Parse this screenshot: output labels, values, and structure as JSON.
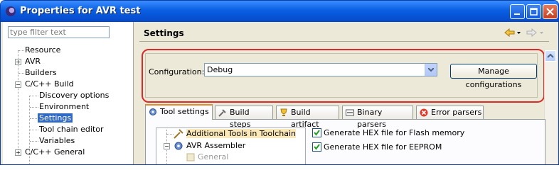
{
  "window": {
    "title": "Properties for AVR test"
  },
  "filter": {
    "placeholder": "type filter text"
  },
  "tree": {
    "items": [
      {
        "label": "Resource"
      },
      {
        "label": "AVR"
      },
      {
        "label": "Builders"
      },
      {
        "label": "C/C++ Build"
      },
      {
        "label": "Discovery options"
      },
      {
        "label": "Environment"
      },
      {
        "label": "Settings"
      },
      {
        "label": "Tool chain editor"
      },
      {
        "label": "Variables"
      },
      {
        "label": "C/C++ General"
      }
    ]
  },
  "page": {
    "title": "Settings"
  },
  "configuration": {
    "label": "Configuration:",
    "value": "Debug",
    "manage_button": "Manage configurations"
  },
  "tabs": [
    {
      "label": "Tool settings",
      "icon": "tool-settings-icon"
    },
    {
      "label": "Build steps",
      "icon": "build-steps-icon"
    },
    {
      "label": "Build artifact",
      "icon": "build-artifact-icon"
    },
    {
      "label": "Binary parsers",
      "icon": "binary-parsers-icon"
    },
    {
      "label": "Error parsers",
      "icon": "error-parsers-icon"
    }
  ],
  "tools": [
    {
      "label": "Additional Tools in Toolchain"
    },
    {
      "label": "AVR Assembler"
    },
    {
      "label": "General"
    }
  ],
  "options": [
    {
      "label": "Generate HEX file for Flash memory",
      "checked": true
    },
    {
      "label": "Generate HEX file for EEPROM",
      "checked": true
    }
  ],
  "colors": {
    "selection": "#316ac5",
    "highlight_box": "#d82b2b",
    "titlebar": "#0a5fe3"
  }
}
